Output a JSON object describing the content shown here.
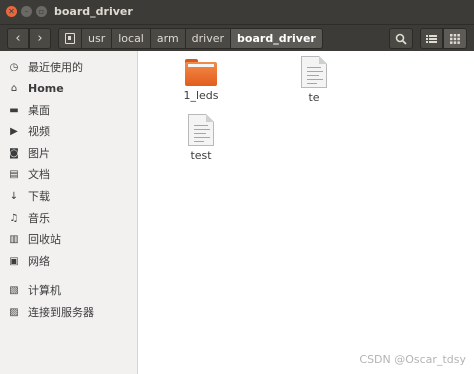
{
  "window": {
    "title": "board_driver"
  },
  "toolbar": {
    "back_icon": "chevron-left",
    "forward_icon": "chevron-right",
    "breadcrumb": [
      "usr",
      "local",
      "arm",
      "driver",
      "board_driver"
    ],
    "search_icon": "search",
    "list_view_icon": "list",
    "grid_view_icon": "grid"
  },
  "sidebar": {
    "items": [
      {
        "label": "最近使用的",
        "icon": "recent-clock"
      },
      {
        "label": "Home",
        "icon": "home"
      },
      {
        "label": "桌面",
        "icon": "desktop-folder"
      },
      {
        "label": "视频",
        "icon": "video"
      },
      {
        "label": "图片",
        "icon": "camera"
      },
      {
        "label": "文档",
        "icon": "document"
      },
      {
        "label": "下载",
        "icon": "download-arrow"
      },
      {
        "label": "音乐",
        "icon": "music-note"
      },
      {
        "label": "回收站",
        "icon": "trash"
      },
      {
        "label": "网络",
        "icon": "network"
      },
      {
        "label": "计算机",
        "icon": "computer"
      },
      {
        "label": "连接到服务器",
        "icon": "server"
      }
    ]
  },
  "files": [
    {
      "name": "1_leds",
      "type": "folder"
    },
    {
      "name": "te",
      "type": "text-file"
    },
    {
      "name": "test",
      "type": "text-file"
    }
  ],
  "watermark": "CSDN @Oscar_tdsy"
}
